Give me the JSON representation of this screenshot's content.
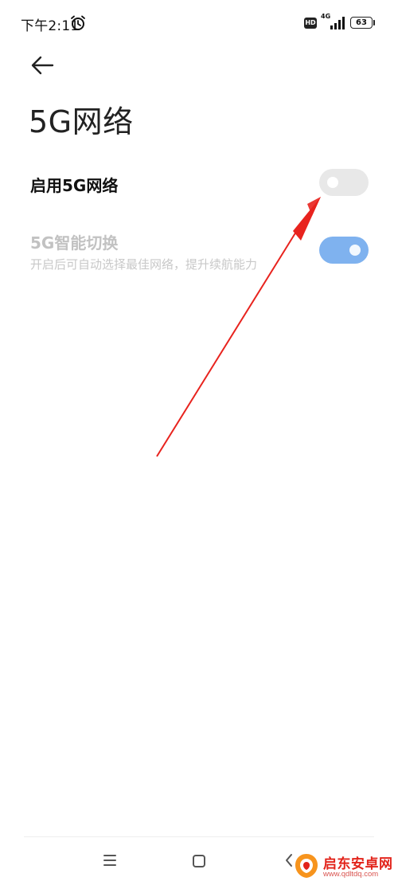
{
  "status_bar": {
    "time": "下午2:11",
    "hd_label": "HD",
    "network_type": "4G",
    "battery_level": "63"
  },
  "page": {
    "title": "5G网络"
  },
  "settings": [
    {
      "title": "启用5G网络",
      "enabled": false
    },
    {
      "title": "5G智能切换",
      "subtitle": "开启后可自动选择最佳网络，提升续航能力",
      "enabled": true,
      "disabled": true
    }
  ],
  "colors": {
    "toggle_on": "#7fb2ef",
    "toggle_off": "#e8e8e8",
    "annotation": "#e8231e",
    "disabled_text": "#c2c2c2"
  },
  "watermark": {
    "title": "启东安卓网",
    "url": "www.qdltdq.com"
  },
  "icons": {
    "status_alarm": "alarm-clock-icon",
    "status_signal": "signal-bars-icon",
    "back": "arrow-left-icon",
    "nav_menu": "menu-lines-icon",
    "nav_home": "square-home-icon",
    "nav_back": "chevron-left-icon"
  }
}
